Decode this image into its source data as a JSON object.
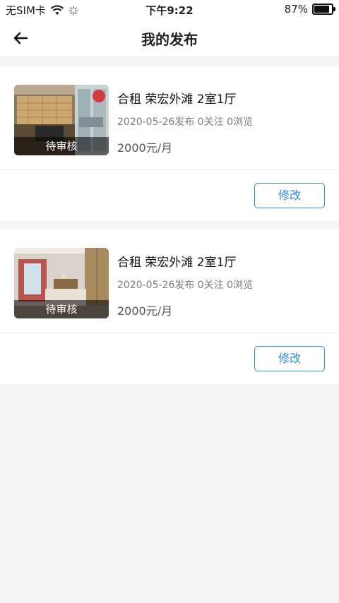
{
  "status_bar": {
    "carrier": "无SIM卡",
    "time": "下午9:22",
    "battery": "87%",
    "battery_level": 0.87
  },
  "nav": {
    "title": "我的发布"
  },
  "listings": [
    {
      "title": "合租 荣宏外滩 2室1厅",
      "meta": "2020-05-26发布 0关注 0浏览",
      "price": "2000元/月",
      "status": "待审核",
      "edit_label": "修改",
      "image": "kitchen-photo"
    },
    {
      "title": "合租 荣宏外滩 2室1厅",
      "meta": "2020-05-26发布 0关注 0浏览",
      "price": "2000元/月",
      "status": "待审核",
      "edit_label": "修改",
      "image": "bedroom-photo"
    }
  ],
  "colors": {
    "accent": "#2d8ae0",
    "background": "#f4f4f4"
  }
}
